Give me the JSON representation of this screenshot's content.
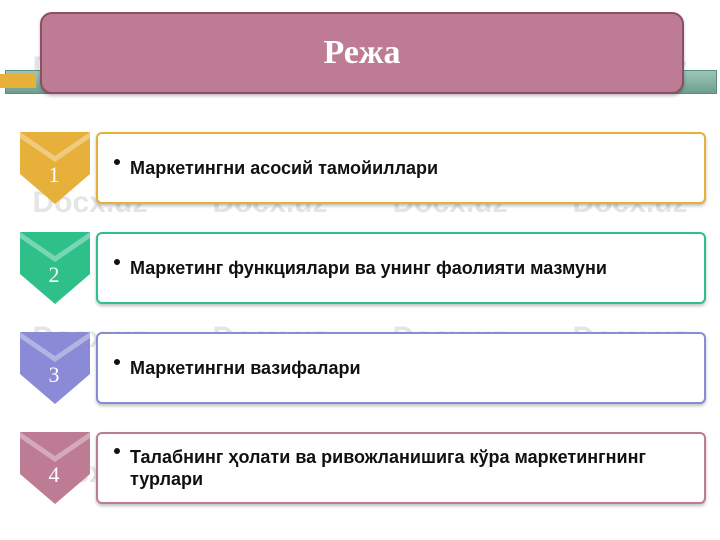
{
  "watermark": "Docx.uz",
  "title": "Режа",
  "items": [
    {
      "num": "1",
      "text": "Маркетингни асосий тамойиллари",
      "color": "#e6b03a"
    },
    {
      "num": "2",
      "text": " Маркетинг функциялари ва унинг фаолияти мазмуни",
      "color": "#2fc08a"
    },
    {
      "num": "3",
      "text": " Маркетингни вазифалари",
      "color": "#8a8ad6"
    },
    {
      "num": "4",
      "text": " Талабнинг ҳолати ва ривожланишига кўра маркетингнинг турлари",
      "color": "#be7b94"
    }
  ]
}
